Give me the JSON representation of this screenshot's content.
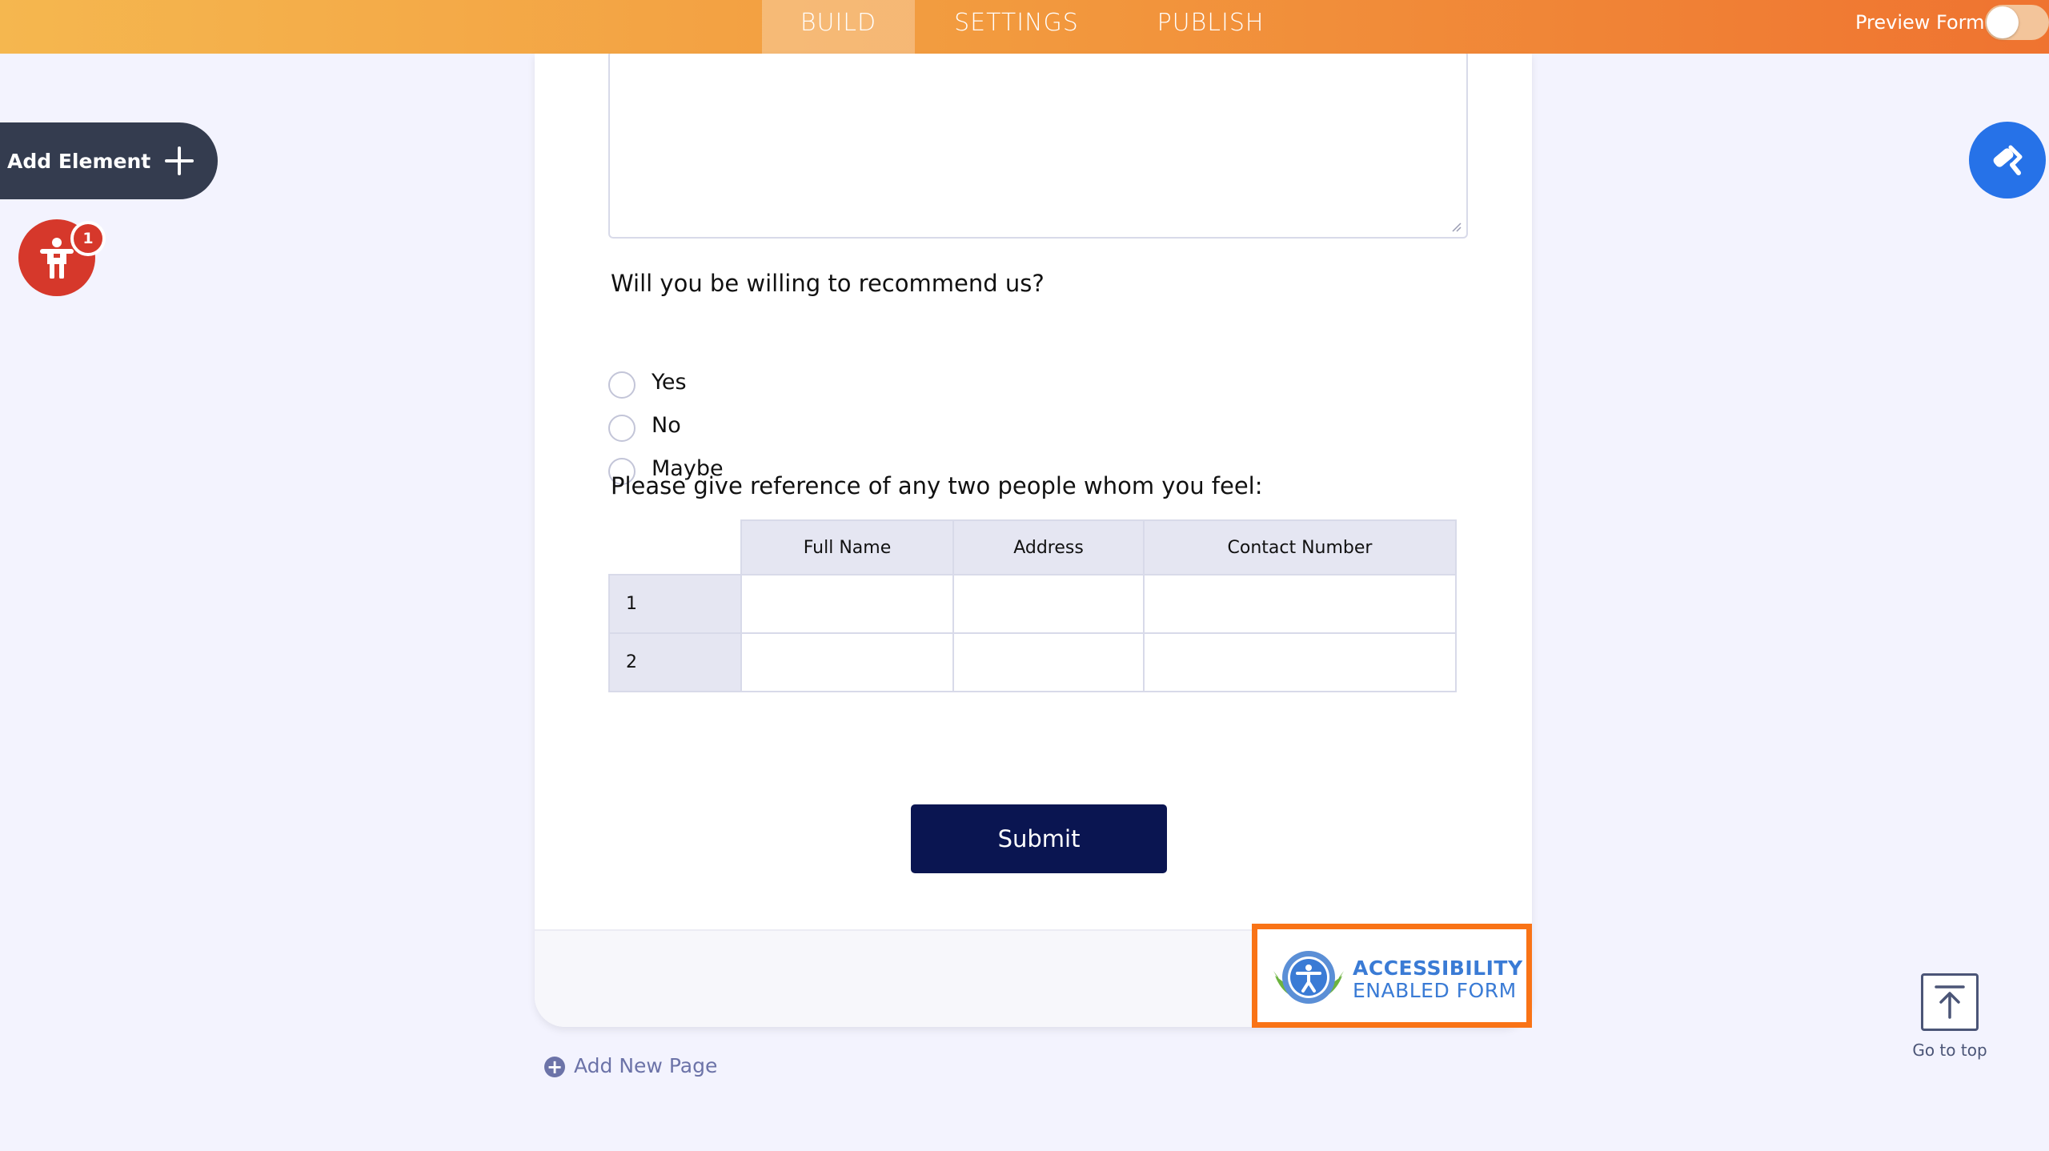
{
  "topbar": {
    "tabs": [
      {
        "label": "BUILD",
        "active": true
      },
      {
        "label": "SETTINGS",
        "active": false
      },
      {
        "label": "PUBLISH",
        "active": false
      }
    ],
    "preview_label": "Preview Form",
    "preview_toggle_on": false,
    "gradient_colors": [
      "#f5b74f",
      "#ef7330"
    ]
  },
  "left_panel": {
    "add_element_label": "Add Element",
    "accessibility_icon": "accessibility-person-icon",
    "accessibility_badge_count": "1"
  },
  "right_panel": {
    "designer_icon": "paint-roller-icon"
  },
  "form": {
    "question_recommend": "Will you be willing to recommend us?",
    "options": [
      "Yes",
      "No",
      "Maybe"
    ],
    "question_reference": "Please give reference of any two people whom you feel:",
    "matrix": {
      "columns": [
        "Full Name",
        "Address",
        "Contact Number"
      ],
      "rows": [
        "1",
        "2"
      ]
    },
    "submit_label": "Submit",
    "submit_color": "#0a1551"
  },
  "accessibility_badge": {
    "line1": "ACCESSIBILITY",
    "line2": "ENABLED FORM",
    "highlight_color": "#f97316"
  },
  "add_page_label": "Add New Page",
  "go_to_top_label": "Go to top"
}
